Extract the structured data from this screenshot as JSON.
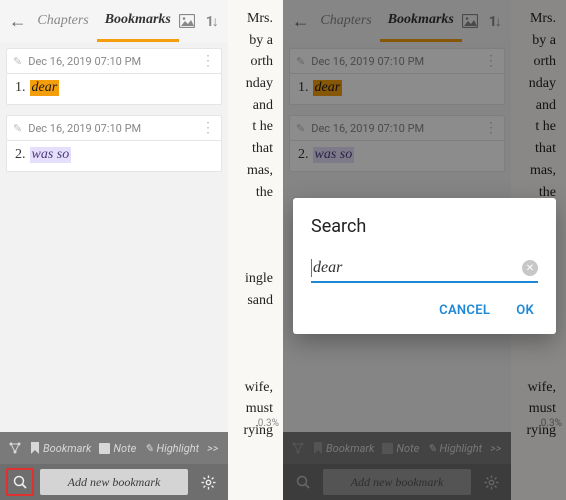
{
  "tabs": {
    "chapters": "Chapters",
    "bookmarks": "Bookmarks"
  },
  "bookmarks": [
    {
      "date": "Dec 16, 2019 07:10 PM",
      "num": "1.",
      "text": "dear",
      "hl": "orange"
    },
    {
      "date": "Dec 16, 2019 07:10 PM",
      "num": "2.",
      "text": "was so",
      "hl": "lav"
    }
  ],
  "toolbar": {
    "bookmark": "Bookmark",
    "note": "Note",
    "highlight": "Highlight",
    "more": ">>"
  },
  "bottom": {
    "add": "Add new bookmark"
  },
  "percent": "0.3%",
  "dialog": {
    "title": "Search",
    "value": "dear",
    "cancel": "CANCEL",
    "ok": "OK"
  },
  "bg_words": [
    "Mrs.",
    "by a",
    "orth",
    "nday",
    " and",
    "t  he",
    "that",
    "mas,",
    "  the",
    "",
    "",
    "ingle",
    "sand",
    "",
    "",
    "wife,",
    "must",
    "rying"
  ]
}
